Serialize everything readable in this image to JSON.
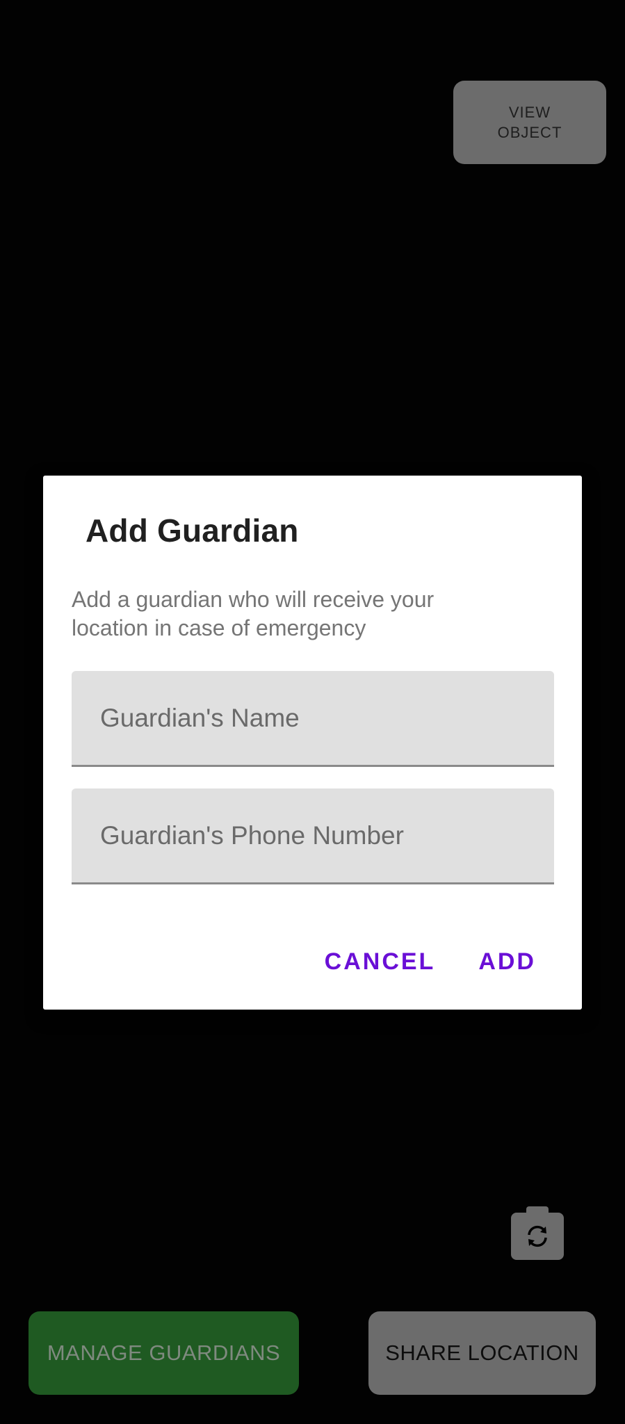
{
  "camera": {
    "view_object_label": "VIEW\nOBJECT",
    "switch_camera_icon": "switch-camera-icon"
  },
  "bottom_bar": {
    "manage_guardians_label": "MANAGE GUARDIANS",
    "share_location_label": "SHARE LOCATION"
  },
  "dialog": {
    "title": "Add Guardian",
    "message": "Add a guardian who will receive your location in case of emergency",
    "name_placeholder": "Guardian's Name",
    "phone_placeholder": "Guardian's Phone Number",
    "cancel_label": "CANCEL",
    "add_label": "ADD"
  },
  "colors": {
    "accent": "#6a0fd6",
    "manage_guardians_bg": "#1f5a22",
    "button_gray": "#6c6c6c",
    "dialog_bg": "#ffffff",
    "field_bg": "#e0e0e0"
  }
}
